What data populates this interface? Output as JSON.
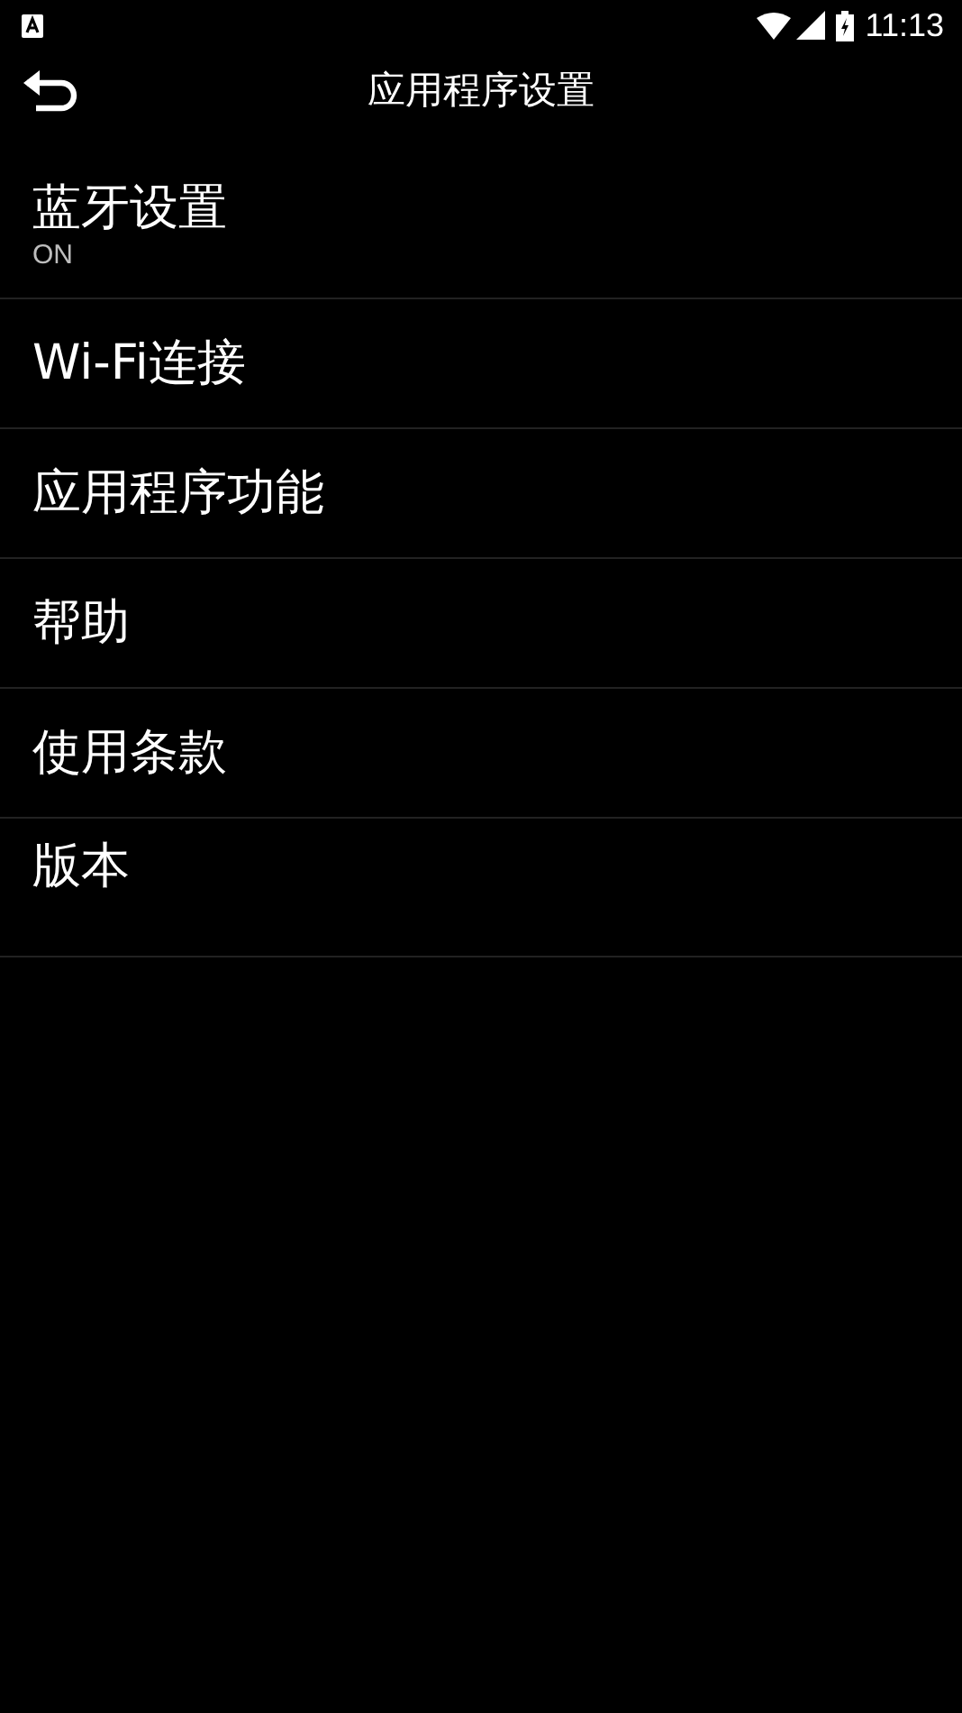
{
  "status_bar": {
    "time": "11:13"
  },
  "app_bar": {
    "title": "应用程序设置"
  },
  "items": [
    {
      "title": "蓝牙设置",
      "subtitle": "ON"
    },
    {
      "title": "Wi-Fi连接"
    },
    {
      "title": "应用程序功能"
    },
    {
      "title": "帮助"
    },
    {
      "title": "使用条款"
    },
    {
      "title": "版本"
    }
  ]
}
